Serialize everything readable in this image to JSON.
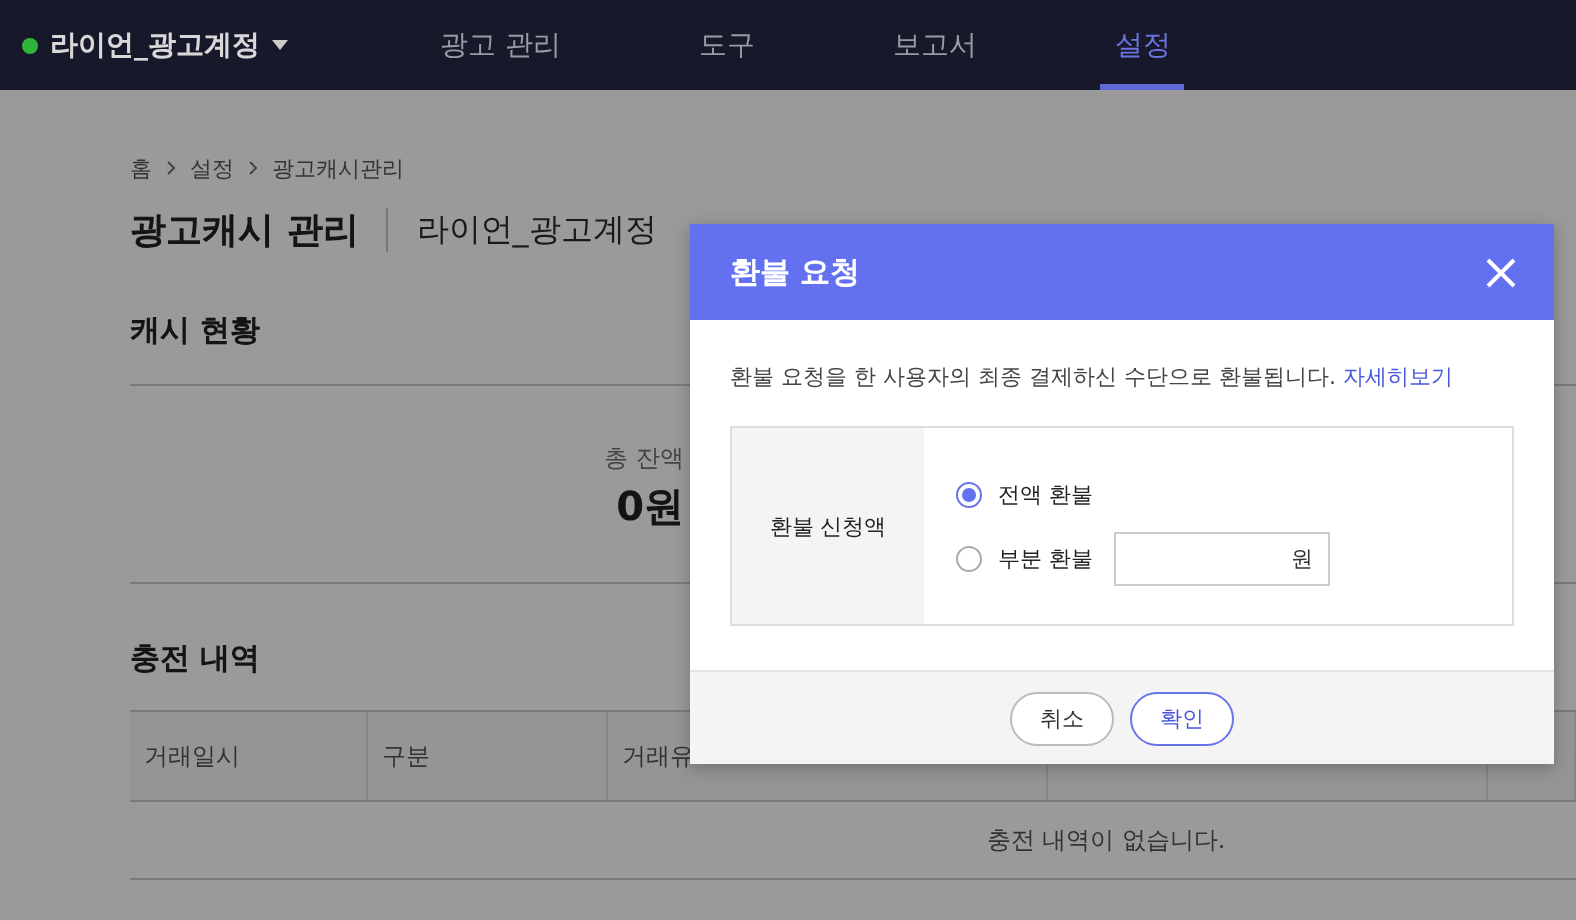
{
  "nav": {
    "account": "라이언_광고계정",
    "items": [
      {
        "label": "광고 관리",
        "selected": false
      },
      {
        "label": "도구",
        "selected": false
      },
      {
        "label": "보고서",
        "selected": false
      },
      {
        "label": "설정",
        "selected": true
      }
    ]
  },
  "breadcrumb": [
    "홈",
    "설정",
    "광고캐시관리"
  ],
  "page": {
    "title": "광고캐시 관리",
    "account": "라이언_광고계정"
  },
  "cash_status": {
    "heading": "캐시 현황",
    "balance_label": "총 잔액",
    "balance": "0원"
  },
  "history": {
    "heading": "충전 내역",
    "columns": [
      "거래일시",
      "구분",
      "거래유"
    ],
    "empty_message": "충전 내역이 없습니다."
  },
  "dialog": {
    "title": "환불 요청",
    "notice": "환불 요청을 한 사용자의 최종 결제하신 수단으로 환불됩니다.",
    "notice_link": "자세히보기",
    "field_label": "환불 신청액",
    "options": [
      {
        "label": "전액 환불",
        "selected": true,
        "kind": "plain"
      },
      {
        "label": "부분 환불",
        "selected": false,
        "kind": "amount"
      }
    ],
    "amount_unit": "원",
    "buttons": [
      {
        "label": "취소",
        "kind": "secondary"
      },
      {
        "label": "확인",
        "kind": "primary"
      }
    ]
  }
}
